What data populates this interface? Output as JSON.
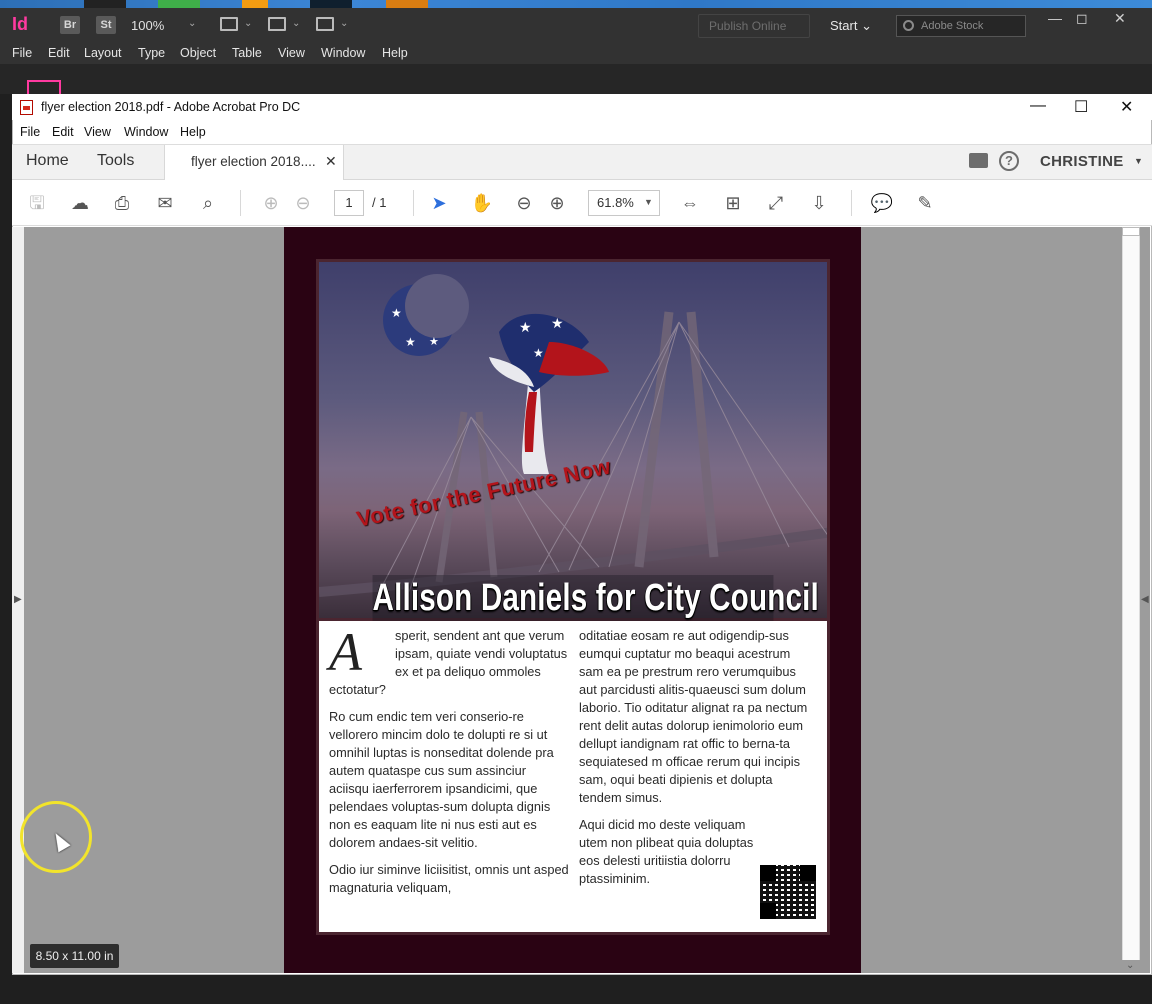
{
  "indesign": {
    "zoom": "100%",
    "badges": [
      "Br",
      "St"
    ],
    "publish_label": "Publish Online",
    "start_label": "Start",
    "stock_placeholder": "Adobe Stock",
    "menu": [
      "File",
      "Edit",
      "Layout",
      "Type",
      "Object",
      "Table",
      "View",
      "Window",
      "Help"
    ],
    "accent": "#ff3aa0"
  },
  "acrobat": {
    "window_title": "flyer election 2018.pdf - Adobe Acrobat Pro DC",
    "menu": [
      "File",
      "Edit",
      "View",
      "Window",
      "Help"
    ],
    "nav_tabs": [
      "Home",
      "Tools"
    ],
    "doc_tab_label": "flyer election 2018....",
    "user": "CHRISTINE",
    "page_current": "1",
    "page_total": "/ 1",
    "zoom": "61.8%",
    "page_size": "8.50 x 11.00 in",
    "accent": "#2d6fdc"
  },
  "flyer": {
    "slogan": "Vote for the Future Now",
    "title": "Allison Daniels for City Council",
    "dropcap": "A",
    "col1": [
      "sperit, sendent ant que verum ipsam, quiate vendi voluptatus ex et pa deliquo ommoles ectotatur?",
      "Ro cum endic tem veri conserio-re vellorero mincim dolo te dolupti re si ut omnihil luptas is nonseditat dolende pra autem quataspe cus sum assinciur aciisqu iaerferrorem ipsandicimi, que pelendaes voluptas-sum dolupta dignis non es eaquam lite ni nus esti aut es dolorem andaes-sit velitio.",
      "Odio iur siminve liciisitist, omnis unt asped magnaturia veliquam,"
    ],
    "col2": [
      "oditatiae eosam re aut odigendip-sus eumqui cuptatur mo beaqui acestrum sam ea pe prestrum rero verumquibus aut parcidusti alitis-quaeusci sum dolum laborio. Tio oditatur alignat ra pa nectum rent delit autas dolorup ienimolorio eum dellupt iandignam rat offic to berna-ta sequiatesed m officae rerum qui incipis sam, oqui beati dipienis et dolupta tendem simus.",
      "Aqui dicid mo deste veliquam utem non plibeat quia doluptas eos delesti uritiistia dolorru ptassiminim."
    ],
    "colors": {
      "page_bg": "#2a0313",
      "slogan": "#b3141b"
    }
  }
}
